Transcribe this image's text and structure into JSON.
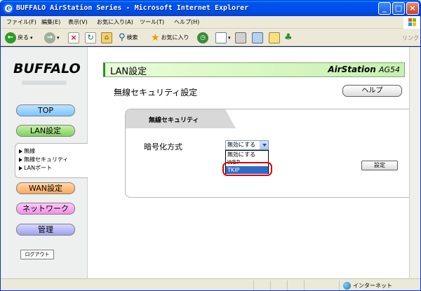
{
  "window": {
    "title": "BUFFALO AirStation Series - Microsoft Internet Explorer"
  },
  "menubar": {
    "items": [
      "ファイル(F)",
      "編集(E)",
      "表示(V)",
      "お気に入り(A)",
      "ツール(T)",
      "ヘルプ(H)"
    ]
  },
  "toolbar": {
    "back_label": "戻る",
    "search_label": "検索",
    "favorites_label": "お気に入り",
    "links_label": "リンク"
  },
  "sidebar": {
    "logo": "BUFFALO",
    "nav": {
      "top": "TOP",
      "lan": "LAN設定",
      "wan": "WAN設定",
      "network": "ネットワーク",
      "admin": "管理"
    },
    "submenu": [
      "無線",
      "無線セキュリティ",
      "LANポート"
    ],
    "logout": "ログアウト"
  },
  "content": {
    "header_title": "LAN設定",
    "header_brand": "AirStation",
    "header_model": "AG54",
    "section_title": "無線セキュリティ設定",
    "help_button": "ヘルプ",
    "panel_tab": "無線セキュリティ",
    "encryption_label": "暗号化方式",
    "select_value": "無効にする",
    "options": [
      "無効にする",
      "WEP",
      "TKIP"
    ],
    "selected_option": "TKIP",
    "set_button": "設定"
  },
  "statusbar": {
    "zone": "インターネット"
  }
}
